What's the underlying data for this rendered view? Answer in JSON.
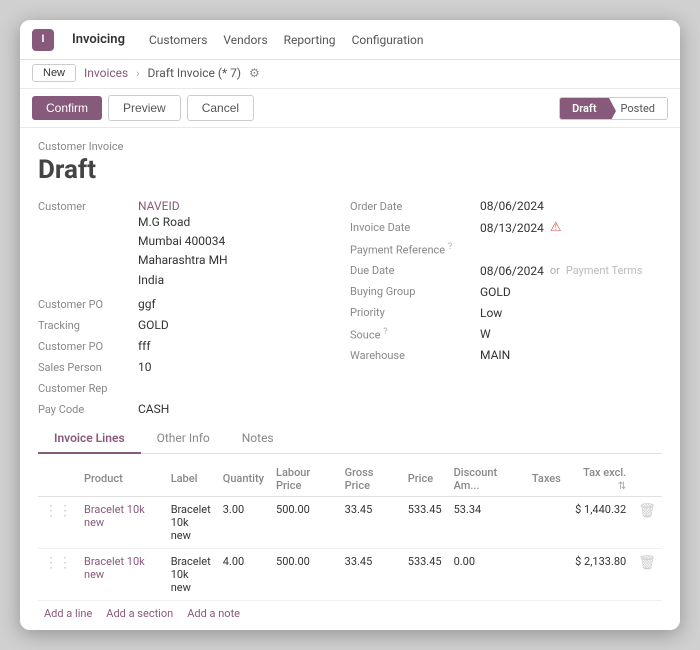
{
  "topbar": {
    "logo": "I",
    "appname": "Invoicing",
    "nav": [
      "Customers",
      "Vendors",
      "Reporting",
      "Configuration"
    ]
  },
  "breadcrumb": {
    "new_btn": "New",
    "parent": "Invoices",
    "current": "Draft Invoice (* 7)"
  },
  "actions": {
    "confirm": "Confirm",
    "preview": "Preview",
    "cancel": "Cancel",
    "status_draft": "Draft",
    "status_posted": "Posted"
  },
  "form": {
    "type_label": "Customer Invoice",
    "title": "Draft",
    "customer_label": "Customer",
    "customer_name": "NAVEID",
    "address_line1": "M.G Road",
    "address_line2": "Mumbai 400034",
    "address_line3": "Maharashtra MH",
    "address_line4": "India",
    "customer_po_label": "Customer PO",
    "customer_po_value": "ggf",
    "tracking_label": "Tracking",
    "tracking_value": "GOLD",
    "customer_po2_label": "Customer PO",
    "customer_po2_value": "fff",
    "sales_person_label": "Sales Person",
    "sales_person_value": "10",
    "customer_rep_label": "Customer Rep",
    "customer_rep_value": "",
    "pay_code_label": "Pay Code",
    "pay_code_value": "CASH",
    "order_date_label": "Order Date",
    "order_date_value": "08/06/2024",
    "invoice_date_label": "Invoice Date",
    "invoice_date_value": "08/13/2024",
    "payment_ref_label": "Payment Reference",
    "due_date_label": "Due Date",
    "due_date_value": "08/06/2024",
    "or_text": "or",
    "payment_terms_placeholder": "Payment Terms",
    "buying_group_label": "Buying Group",
    "buying_group_value": "GOLD",
    "priority_label": "Priority",
    "priority_value": "Low",
    "souce_label": "Souce",
    "souce_value": "W",
    "warehouse_label": "Warehouse",
    "warehouse_value": "MAIN"
  },
  "tabs": [
    {
      "label": "Invoice Lines",
      "active": true
    },
    {
      "label": "Other Info",
      "active": false
    },
    {
      "label": "Notes",
      "active": false
    }
  ],
  "table": {
    "headers": [
      "",
      "Product",
      "Label",
      "Quantity",
      "Labour Price",
      "Gross Price",
      "Price",
      "Discount Am...",
      "Taxes",
      "Tax excl."
    ],
    "rows": [
      {
        "product": "Bracelet 10k new",
        "label": "Bracelet 10k new",
        "quantity": "3.00",
        "labour_price": "500.00",
        "gross_price": "33.45",
        "price": "533.45",
        "discount": "53.34",
        "taxes": "",
        "tax_excl": "$ 1,440.32"
      },
      {
        "product": "Bracelet 10k new",
        "label": "Bracelet 10k new",
        "quantity": "4.00",
        "labour_price": "500.00",
        "gross_price": "33.45",
        "price": "533.45",
        "discount": "0.00",
        "taxes": "",
        "tax_excl": "$ 2,133.80"
      }
    ],
    "add_line": "Add a line",
    "add_section": "Add a section",
    "add_note": "Add a note"
  }
}
